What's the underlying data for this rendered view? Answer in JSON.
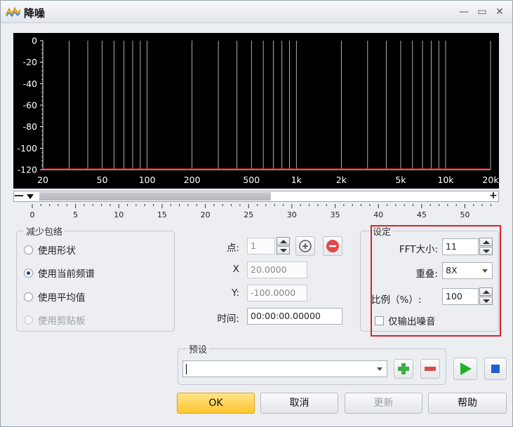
{
  "window": {
    "title": "降噪",
    "minimize_glyph": "—",
    "maximize_glyph": "▭",
    "close_glyph": "✕"
  },
  "spectrum": {
    "y_ticks": [
      "0",
      "-20",
      "-40",
      "-60",
      "-80",
      "-100",
      "-120"
    ],
    "x_ticks": [
      "20",
      "50",
      "100",
      "200",
      "500",
      "1k",
      "2k",
      "5k",
      "10k",
      "20k"
    ],
    "line_color": "#cc2222",
    "grid_color": "#ffffff"
  },
  "timeline": {
    "minus_label": "—",
    "plus_label": "+",
    "ticks": [
      "0",
      "5",
      "10",
      "15",
      "20",
      "25",
      "30",
      "35",
      "40",
      "45",
      "50"
    ]
  },
  "reduce_envelope": {
    "title": "减少包络",
    "options": [
      {
        "label": "使用形状",
        "checked": false,
        "disabled": false
      },
      {
        "label": "使用当前频谱",
        "checked": true,
        "disabled": false
      },
      {
        "label": "使用平均值",
        "checked": false,
        "disabled": false
      },
      {
        "label": "使用剪贴板",
        "checked": false,
        "disabled": true
      }
    ]
  },
  "point": {
    "point_label": "点:",
    "point_value": "1",
    "x_label": "X",
    "x_value": "20.0000",
    "y_label": "Y:",
    "y_value": "-100.0000",
    "time_label": "时间:",
    "time_value": "00:00:00.00000"
  },
  "settings": {
    "title": "设定",
    "fft_label": "FFT大小:",
    "fft_value": "11",
    "overlap_label": "重叠:",
    "overlap_value": "8X",
    "ratio_label": "比例（%）:",
    "ratio_value": "100",
    "noise_only_label": "仅输出噪音"
  },
  "preset": {
    "title": "预设",
    "value": ""
  },
  "buttons": {
    "ok": "OK",
    "cancel": "取消",
    "update": "更新",
    "help": "帮助"
  },
  "colors": {
    "add": "#3cb043",
    "remove": "#e04a4a",
    "play": "#22b22a",
    "stop": "#1f5fd6"
  }
}
